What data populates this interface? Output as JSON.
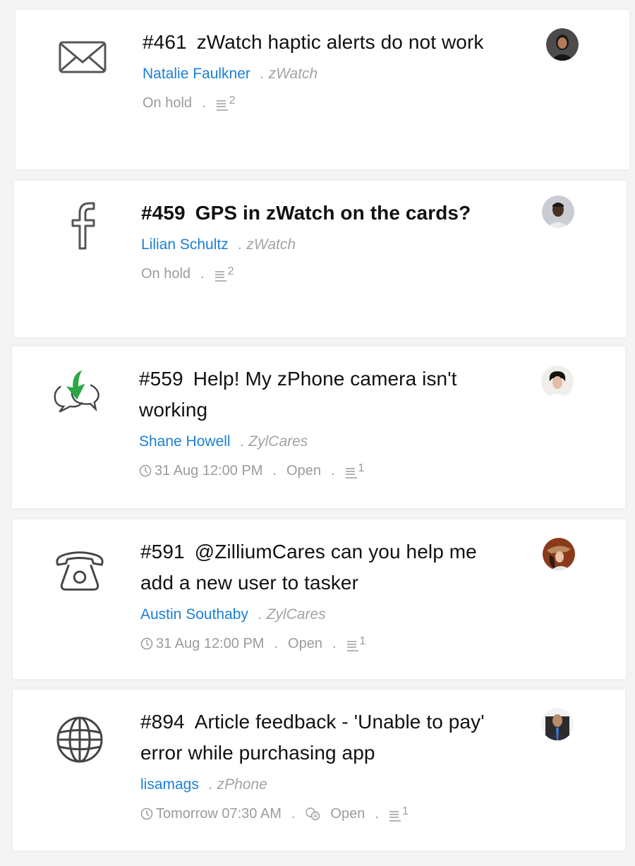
{
  "tickets": [
    {
      "channel_icon": "mail-icon",
      "number": "#461",
      "subject": "zWatch haptic alerts do not work",
      "bold": false,
      "contact": "Natalie Faulkner",
      "product": "zWatch",
      "due": null,
      "status": "On hold",
      "thread_count": "2",
      "avatar": "avatar-natalie-faulkner"
    },
    {
      "channel_icon": "facebook-icon",
      "number": "#459",
      "subject": "GPS in zWatch on the cards?",
      "bold": true,
      "contact": "Lilian Schultz",
      "product": "zWatch",
      "due": null,
      "status": "On hold",
      "thread_count": "2",
      "avatar": "avatar-lilian-schultz"
    },
    {
      "channel_icon": "chat-incoming-icon",
      "number": "#559",
      "subject": "Help! My zPhone camera isn't working",
      "bold": false,
      "contact": "Shane Howell",
      "product": "ZylCares",
      "due": "31 Aug 12:00 PM",
      "status": "Open",
      "thread_count": "1",
      "avatar": "avatar-shane-howell"
    },
    {
      "channel_icon": "phone-icon",
      "number": "#591",
      "subject": "@ZilliumCares can you help me add a new user to tasker",
      "bold": false,
      "contact": "Austin Southaby",
      "product": "ZylCares",
      "due": "31 Aug 12:00 PM",
      "status": "Open",
      "thread_count": "1",
      "avatar": "avatar-austin-southaby"
    },
    {
      "channel_icon": "globe-icon",
      "number": "#894",
      "subject": "Article feedback - 'Unable to pay' error while purchasing app",
      "bold": false,
      "contact": "lisamags",
      "product": "zPhone",
      "due": "Tomorrow 07:30 AM",
      "status": "Open",
      "status_icon": "merge-icon",
      "thread_count": "1",
      "avatar": "avatar-lisamags"
    }
  ],
  "separator": ".",
  "colors": {
    "contact_link": "#1a7fd6",
    "meta_text": "#9b9b9b",
    "incoming_arrow": "#2aa845"
  }
}
